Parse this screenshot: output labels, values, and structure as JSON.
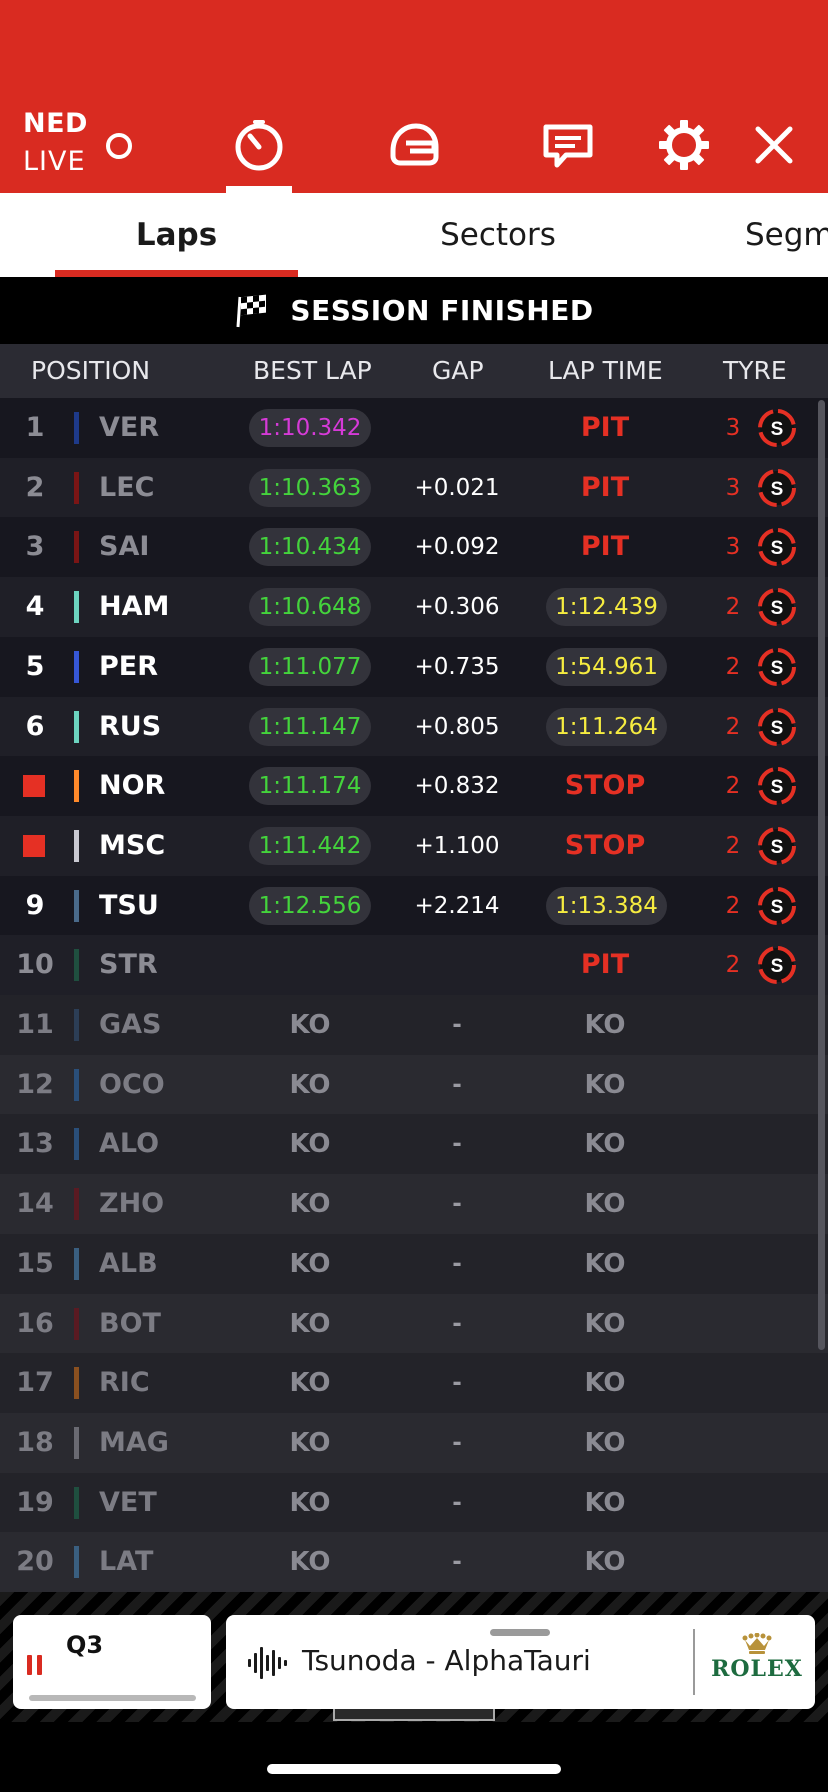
{
  "header": {
    "country": "NED",
    "live_label": "LIVE",
    "icons": [
      "live-indicator-icon",
      "timer-icon",
      "helmet-icon",
      "message-icon",
      "gear-icon",
      "close-icon"
    ]
  },
  "tabs": [
    {
      "label": "Laps",
      "active": true
    },
    {
      "label": "Sectors",
      "active": false
    },
    {
      "label": "Segm",
      "active": false
    }
  ],
  "session": {
    "status": "SESSION FINISHED"
  },
  "columns": {
    "position": "POSITION",
    "best_lap": "BEST LAP",
    "gap": "GAP",
    "lap_time": "LAP TIME",
    "tyre": "TYRE"
  },
  "rows": [
    {
      "pos": "1",
      "driver": "VER",
      "team_color": "#1e3a8a",
      "best_lap": "1:10.342",
      "best_color": "#d63ad8",
      "gap": "",
      "lap_time": "PIT",
      "lap_style": "status",
      "laps": "3",
      "tyre": "S",
      "state": "dim"
    },
    {
      "pos": "2",
      "driver": "LEC",
      "team_color": "#7a1515",
      "best_lap": "1:10.363",
      "best_color": "#44d43c",
      "gap": "+0.021",
      "lap_time": "PIT",
      "lap_style": "status",
      "laps": "3",
      "tyre": "S",
      "state": "dim"
    },
    {
      "pos": "3",
      "driver": "SAI",
      "team_color": "#7a1515",
      "best_lap": "1:10.434",
      "best_color": "#44d43c",
      "gap": "+0.092",
      "lap_time": "PIT",
      "lap_style": "status",
      "laps": "3",
      "tyre": "S",
      "state": "dim"
    },
    {
      "pos": "4",
      "driver": "HAM",
      "team_color": "#6cd3bf",
      "best_lap": "1:10.648",
      "best_color": "#44d43c",
      "gap": "+0.306",
      "lap_time": "1:12.439",
      "lap_style": "pill",
      "laps": "2",
      "tyre": "S",
      "state": "active"
    },
    {
      "pos": "5",
      "driver": "PER",
      "team_color": "#3657d6",
      "best_lap": "1:11.077",
      "best_color": "#44d43c",
      "gap": "+0.735",
      "lap_time": "1:54.961",
      "lap_style": "pill",
      "laps": "2",
      "tyre": "S",
      "state": "active"
    },
    {
      "pos": "6",
      "driver": "RUS",
      "team_color": "#6cd3bf",
      "best_lap": "1:11.147",
      "best_color": "#44d43c",
      "gap": "+0.805",
      "lap_time": "1:11.264",
      "lap_style": "pill",
      "laps": "2",
      "tyre": "S",
      "state": "active"
    },
    {
      "pos": "",
      "driver": "NOR",
      "team_color": "#ff8a2b",
      "best_lap": "1:11.174",
      "best_color": "#44d43c",
      "gap": "+0.832",
      "lap_time": "STOP",
      "lap_style": "status",
      "laps": "2",
      "tyre": "S",
      "state": "active",
      "flag": true
    },
    {
      "pos": "",
      "driver": "MSC",
      "team_color": "#c9c9d2",
      "best_lap": "1:11.442",
      "best_color": "#44d43c",
      "gap": "+1.100",
      "lap_time": "STOP",
      "lap_style": "status",
      "laps": "2",
      "tyre": "S",
      "state": "active",
      "flag": true
    },
    {
      "pos": "9",
      "driver": "TSU",
      "team_color": "#4a6a8a",
      "best_lap": "1:12.556",
      "best_color": "#44d43c",
      "gap": "+2.214",
      "lap_time": "1:13.384",
      "lap_style": "pill",
      "laps": "2",
      "tyre": "S",
      "state": "active"
    },
    {
      "pos": "10",
      "driver": "STR",
      "team_color": "#1f4f3f",
      "best_lap": "",
      "best_color": "#44d43c",
      "gap": "",
      "lap_time": "PIT",
      "lap_style": "status",
      "laps": "2",
      "tyre": "S",
      "state": "dim"
    },
    {
      "pos": "11",
      "driver": "GAS",
      "team_color": "#2c3e56",
      "best_lap": "KO",
      "gap": "-",
      "lap_time": "KO",
      "lap_style": "ko",
      "state": "out"
    },
    {
      "pos": "12",
      "driver": "OCO",
      "team_color": "#2a4f7a",
      "best_lap": "KO",
      "gap": "-",
      "lap_time": "KO",
      "lap_style": "ko",
      "state": "out"
    },
    {
      "pos": "13",
      "driver": "ALO",
      "team_color": "#2a4f7a",
      "best_lap": "KO",
      "gap": "-",
      "lap_time": "KO",
      "lap_style": "ko",
      "state": "out"
    },
    {
      "pos": "14",
      "driver": "ZHO",
      "team_color": "#5a1a22",
      "best_lap": "KO",
      "gap": "-",
      "lap_time": "KO",
      "lap_style": "ko",
      "state": "out"
    },
    {
      "pos": "15",
      "driver": "ALB",
      "team_color": "#3a5f80",
      "best_lap": "KO",
      "gap": "-",
      "lap_time": "KO",
      "lap_style": "ko",
      "state": "out"
    },
    {
      "pos": "16",
      "driver": "BOT",
      "team_color": "#5a1a22",
      "best_lap": "KO",
      "gap": "-",
      "lap_time": "KO",
      "lap_style": "ko",
      "state": "out"
    },
    {
      "pos": "17",
      "driver": "RIC",
      "team_color": "#8a5020",
      "best_lap": "KO",
      "gap": "-",
      "lap_time": "KO",
      "lap_style": "ko",
      "state": "out"
    },
    {
      "pos": "18",
      "driver": "MAG",
      "team_color": "#6a6a72",
      "best_lap": "KO",
      "gap": "-",
      "lap_time": "KO",
      "lap_style": "ko",
      "state": "out"
    },
    {
      "pos": "19",
      "driver": "VET",
      "team_color": "#1f4f3f",
      "best_lap": "KO",
      "gap": "-",
      "lap_time": "KO",
      "lap_style": "ko",
      "state": "out"
    },
    {
      "pos": "20",
      "driver": "LAT",
      "team_color": "#3a5f80",
      "best_lap": "KO",
      "gap": "-",
      "lap_time": "KO",
      "lap_style": "ko",
      "state": "out"
    }
  ],
  "bottom": {
    "session_label": "Q3",
    "radio_label": "Tsunoda - AlphaTauri",
    "sponsor": "ROLEX"
  },
  "colors": {
    "brand_red": "#d92b21",
    "status_red": "#e53024",
    "personal_best_green": "#44d43c",
    "fastest_purple": "#d63ad8",
    "lap_time_yellow": "#f6ec40"
  }
}
